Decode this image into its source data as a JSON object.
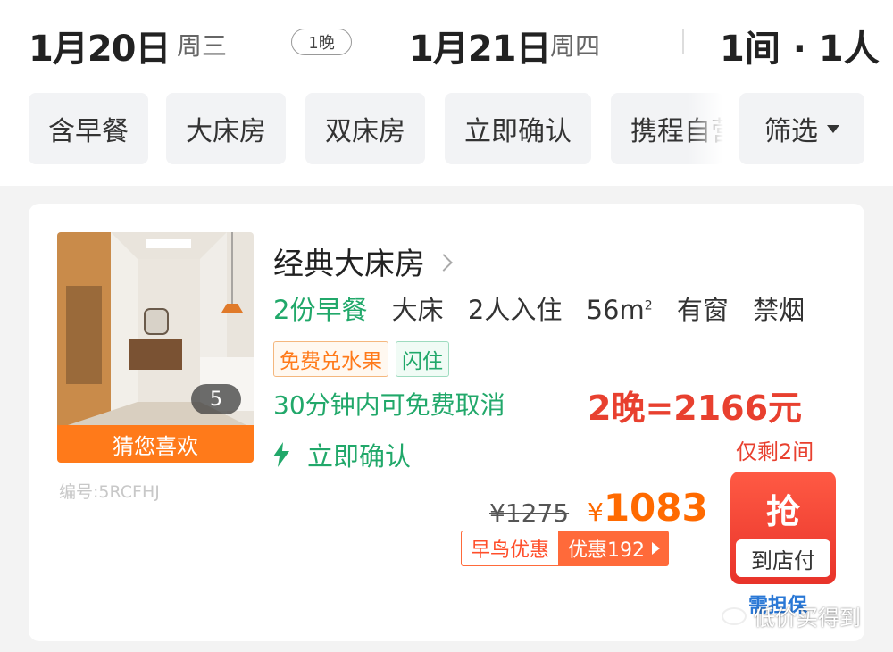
{
  "header": {
    "checkin_date": "1月20日",
    "checkin_weekday": "周三",
    "nights": "1晚",
    "checkout_date": "1月21日",
    "checkout_weekday": "周四",
    "guests": "1间 · 1人"
  },
  "filters": {
    "chips": [
      "含早餐",
      "大床房",
      "双床房",
      "立即确认",
      "携程自营"
    ],
    "filter_label": "筛选"
  },
  "room": {
    "photo_count": "5",
    "photo_tag": "猜您喜欢",
    "room_id": "编号:5RCFHJ",
    "name": "经典大床房",
    "features": {
      "breakfast": "2份早餐",
      "bed": "大床",
      "occupancy": "2人入住",
      "area": "56m",
      "area_sup": "2",
      "window": "有窗",
      "smoking": "禁烟"
    },
    "tags": [
      "免费兑水果",
      "闪住"
    ],
    "cancel_policy": "30分钟内可免费取消",
    "total": "2晚=2166元",
    "instant_confirm": "立即确认",
    "rooms_left": "仅剩2间",
    "original_price": "¥1275",
    "price_symbol": "¥",
    "price": "1083",
    "promo_label": "早鸟优惠",
    "promo_discount": "优惠192",
    "book_button": "抢",
    "pay_method": "到店付",
    "insurance": "需担保"
  },
  "watermark": "低价买得到",
  "colors": {
    "green": "#21a86a",
    "orange": "#ff7a1a",
    "red": "#e8402f",
    "link_blue": "#2a78d6"
  },
  "icons": {
    "lightning": "lightning-icon",
    "chevron": "chevron-right-icon",
    "caret": "caret-down-icon"
  }
}
